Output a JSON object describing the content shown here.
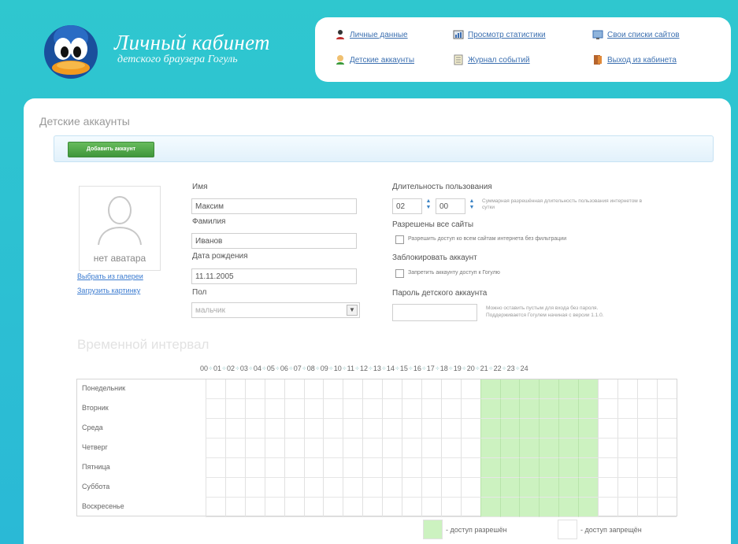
{
  "brand": {
    "title": "Личный кабинет",
    "subtitle": "детского браузера Гогуль"
  },
  "nav": {
    "items": [
      {
        "label": "Личные данные",
        "icon": "user-icon"
      },
      {
        "label": "Просмотр статистики",
        "icon": "stats-icon"
      },
      {
        "label": "Свои списки сайтов",
        "icon": "sites-list-icon"
      },
      {
        "label": "Детские аккаунты",
        "icon": "kids-icon"
      },
      {
        "label": "Журнал событий",
        "icon": "journal-icon"
      },
      {
        "label": "Выход из кабинета",
        "icon": "exit-icon"
      }
    ]
  },
  "page": {
    "title": "Детские аккаунты",
    "add_button": "Добавить аккаунт"
  },
  "avatar": {
    "no_avatar": "нет аватара",
    "choose_from_gallery": "Выбрать из галереи",
    "upload_picture": "Загрузить картинку"
  },
  "form": {
    "first_name_label": "Имя",
    "first_name_value": "Максим",
    "last_name_label": "Фамилия",
    "last_name_value": "Иванов",
    "birth_date_label": "Дата рождения",
    "birth_date_value": "11.11.2005",
    "gender_label": "Пол",
    "gender_value": "мальчик",
    "duration_label": "Длительность пользования",
    "duration_hours": "02",
    "duration_minutes": "00",
    "duration_hint": "Суммарная разрешённая длительность пользования интернетом в сутки",
    "allow_all_label": "Разрешены все сайты",
    "allow_all_checkbox": "Разрешить доступ ко всем сайтам интернета без фильтрации",
    "block_label": "Заблокировать аккаунт",
    "block_checkbox": "Запретить аккаунту доступ к Гогулю",
    "password_label": "Пароль детского аккаунта",
    "password_value": "",
    "password_hint_1": "Можно оставить пустым для входа без пароля.",
    "password_hint_2": "Поддерживается Гогулем начиная с версии 1.1.0."
  },
  "schedule": {
    "title": "Временной интервал",
    "hours": [
      "00",
      "01",
      "02",
      "03",
      "04",
      "05",
      "06",
      "07",
      "08",
      "09",
      "10",
      "11",
      "12",
      "13",
      "14",
      "15",
      "16",
      "17",
      "18",
      "19",
      "20",
      "21",
      "22",
      "23",
      "24"
    ],
    "days": [
      "Понедельник",
      "Вторник",
      "Среда",
      "Четверг",
      "Пятница",
      "Суббота",
      "Воскресенье"
    ],
    "allowed_from_hour": 14,
    "allowed_to_hour": 20,
    "legend_allowed": "- доступ разрешён",
    "legend_denied": "- доступ запрещён",
    "colors": {
      "allowed": "#ccf2c0",
      "denied": "#ffffff"
    }
  },
  "colors": {
    "background": "#2fc7cf",
    "accent_green": "#4aa443",
    "link": "#3b6fb0"
  }
}
